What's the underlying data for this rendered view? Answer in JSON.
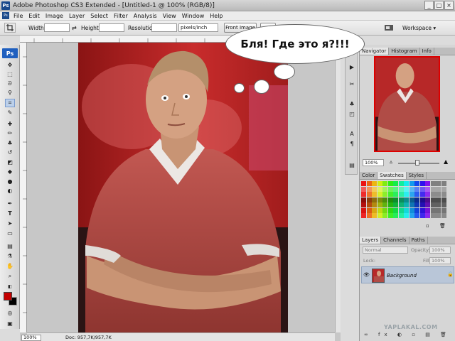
{
  "window": {
    "title": "Adobe Photoshop CS3 Extended - [Untitled-1 @ 100% (RGB/8)]",
    "app_icon": "Ps",
    "controls": [
      "_",
      "□",
      "×"
    ]
  },
  "menu": [
    "File",
    "Edit",
    "Image",
    "Layer",
    "Select",
    "Filter",
    "Analysis",
    "View",
    "Window",
    "Help"
  ],
  "options_bar": {
    "width_label": "Width:",
    "height_label": "Height:",
    "resolution_label": "Resolution:",
    "resolution_unit": "pixels/inch",
    "front_image_button": "Front Image",
    "workspace_label": "Workspace ▾"
  },
  "toolbox": {
    "logo": "Ps",
    "tools": [
      "move-icon",
      "marquee-icon",
      "lasso-icon",
      "magic-wand-icon",
      "crop-icon",
      "slice-icon",
      "healing-icon",
      "brush-icon",
      "clone-stamp-icon",
      "history-brush-icon",
      "eraser-icon",
      "gradient-icon",
      "blur-icon",
      "dodge-icon",
      "pen-icon",
      "type-icon",
      "path-select-icon",
      "shape-icon",
      "notes-icon",
      "eyedropper-icon",
      "hand-icon",
      "zoom-icon"
    ],
    "foreground_color": "#c40000",
    "background_color": "#000000"
  },
  "canvas": {
    "speech_bubble_text": "Бля! Где это я?!!!"
  },
  "status": {
    "zoom": "100%",
    "doc": "Doc: 957,7K/957,7K"
  },
  "panels": {
    "navigator_tabs": [
      "Navigator",
      "Histogram",
      "Info"
    ],
    "navigator_zoom": "100%",
    "color_tabs": [
      "Color",
      "Swatches",
      "Styles"
    ],
    "layers_tabs": [
      "Layers",
      "Channels",
      "Paths"
    ],
    "blend_mode": "Normal",
    "opacity_label": "Opacity:",
    "opacity_value": "100%",
    "lock_label": "Lock:",
    "fill_label": "Fill:",
    "fill_value": "100%",
    "layer_name": "Background"
  },
  "watermark": "YAPLAKAL.COM"
}
